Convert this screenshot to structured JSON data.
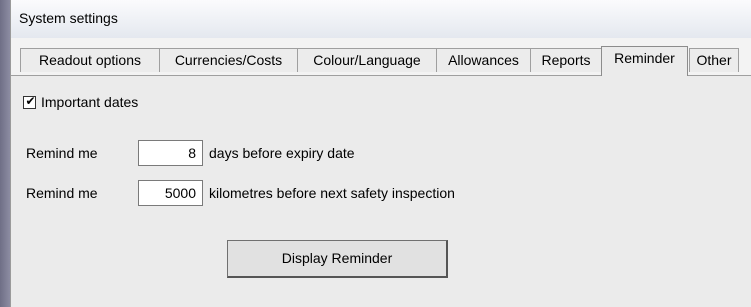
{
  "window": {
    "title": "System settings"
  },
  "tabs": [
    {
      "label": "Readout options",
      "active": false
    },
    {
      "label": "Currencies/Costs",
      "active": false
    },
    {
      "label": "Colour/Language",
      "active": false
    },
    {
      "label": "Allowances",
      "active": false
    },
    {
      "label": "Reports",
      "active": false
    },
    {
      "label": "Reminder",
      "active": true
    },
    {
      "label": "Other",
      "active": false
    }
  ],
  "reminder": {
    "important_dates": {
      "label": "Important dates",
      "checked": true,
      "check_glyph": "✔"
    },
    "days_row": {
      "prefix": "Remind me",
      "value": "8",
      "suffix": "days before expiry date"
    },
    "km_row": {
      "prefix": "Remind me",
      "value": "5000",
      "suffix": "kilometres before next safety inspection"
    },
    "display_button": "Display Reminder"
  }
}
